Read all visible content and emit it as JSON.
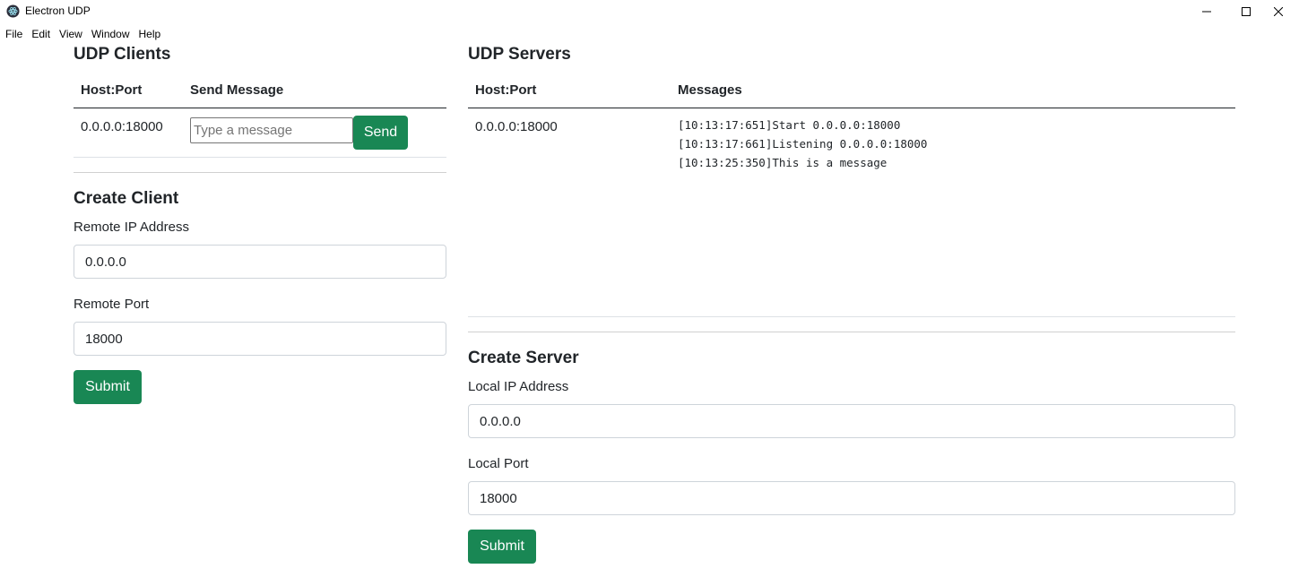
{
  "window": {
    "title": "Electron UDP"
  },
  "menu": [
    "File",
    "Edit",
    "View",
    "Window",
    "Help"
  ],
  "clients": {
    "heading": "UDP Clients",
    "columns": [
      "Host:Port",
      "Send Message"
    ],
    "rows": [
      {
        "host_port": "0.0.0.0:18000",
        "message_placeholder": "Type a message",
        "send_label": "Send"
      }
    ],
    "create": {
      "heading": "Create Client",
      "ip_label": "Remote IP Address",
      "ip_value": "0.0.0.0",
      "port_label": "Remote Port",
      "port_value": "18000",
      "submit_label": "Submit"
    }
  },
  "servers": {
    "heading": "UDP Servers",
    "columns": [
      "Host:Port",
      "Messages"
    ],
    "rows": [
      {
        "host_port": "0.0.0.0:18000",
        "messages": [
          "[10:13:17:651]Start 0.0.0.0:18000",
          "[10:13:17:661]Listening 0.0.0.0:18000",
          "[10:13:25:350]This is a message"
        ]
      }
    ],
    "create": {
      "heading": "Create Server",
      "ip_label": "Local IP Address",
      "ip_value": "0.0.0.0",
      "port_label": "Local Port",
      "port_value": "18000",
      "submit_label": "Submit"
    }
  },
  "colors": {
    "accent": "#198754",
    "text": "#212529",
    "border": "#ced4da"
  }
}
